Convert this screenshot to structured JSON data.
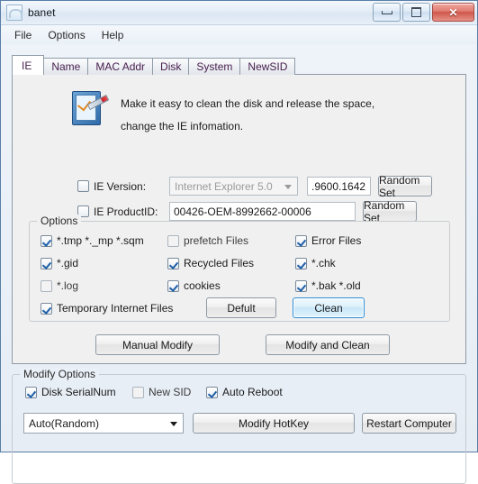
{
  "window": {
    "title": "banet",
    "icon": "app-icon",
    "controls": {
      "minimize": "–",
      "maximize": "□",
      "close": "✕"
    }
  },
  "menubar": {
    "items": [
      "File",
      "Options",
      "Help"
    ]
  },
  "tabs": {
    "active_index": 0,
    "items": [
      "IE",
      "Name",
      "MAC Addr",
      "Disk",
      "System",
      "NewSID"
    ]
  },
  "header": {
    "icon": "clipboard-check-pen-icon",
    "line1": "Make it easy to clean the disk and release the space,",
    "line2": "change the IE infomation."
  },
  "ie_version": {
    "checkbox_label": "IE Version:",
    "checked": false,
    "combo_value": "Internet Explorer 5.0",
    "build_value": ".9600.1642",
    "random_button": "Random Set"
  },
  "ie_productid": {
    "checkbox_label": "IE ProductID:",
    "checked": false,
    "value": "00426-OEM-8992662-00006",
    "random_button": "Random Set"
  },
  "options_group": {
    "caption": "Options",
    "column1": [
      {
        "label": "*.tmp  *._mp  *.sqm",
        "checked": true
      },
      {
        "label": "*.gid",
        "checked": true
      },
      {
        "label": "*.log",
        "checked": false
      },
      {
        "label": "Temporary Internet Files",
        "checked": true
      }
    ],
    "column2": [
      {
        "label": "prefetch Files",
        "checked": false
      },
      {
        "label": "Recycled Files",
        "checked": true
      },
      {
        "label": "cookies",
        "checked": true
      }
    ],
    "column3": [
      {
        "label": "Error Files",
        "checked": true
      },
      {
        "label": "*.chk",
        "checked": true
      },
      {
        "label": "*.bak  *.old",
        "checked": true
      }
    ],
    "default_button": "Defult",
    "clean_button": "Clean"
  },
  "mid_buttons": {
    "manual_modify": "Manual Modify",
    "modify_and_clean": "Modify and Clean"
  },
  "modify_options": {
    "caption": "Modify Options",
    "checkboxes": [
      {
        "label": "Disk SerialNum",
        "checked": true,
        "enabled": true
      },
      {
        "label": "New SID",
        "checked": false,
        "enabled": false
      },
      {
        "label": "Auto Reboot",
        "checked": true,
        "enabled": true
      }
    ],
    "combo_value": "Auto(Random)",
    "hotkey_button": "Modify HotKey",
    "restart_button": "Restart Computer"
  },
  "colors": {
    "accent": "#2e8fd6",
    "panel": "#f0f0f0",
    "frame": "#5a7fa6",
    "close": "#cf564a"
  }
}
